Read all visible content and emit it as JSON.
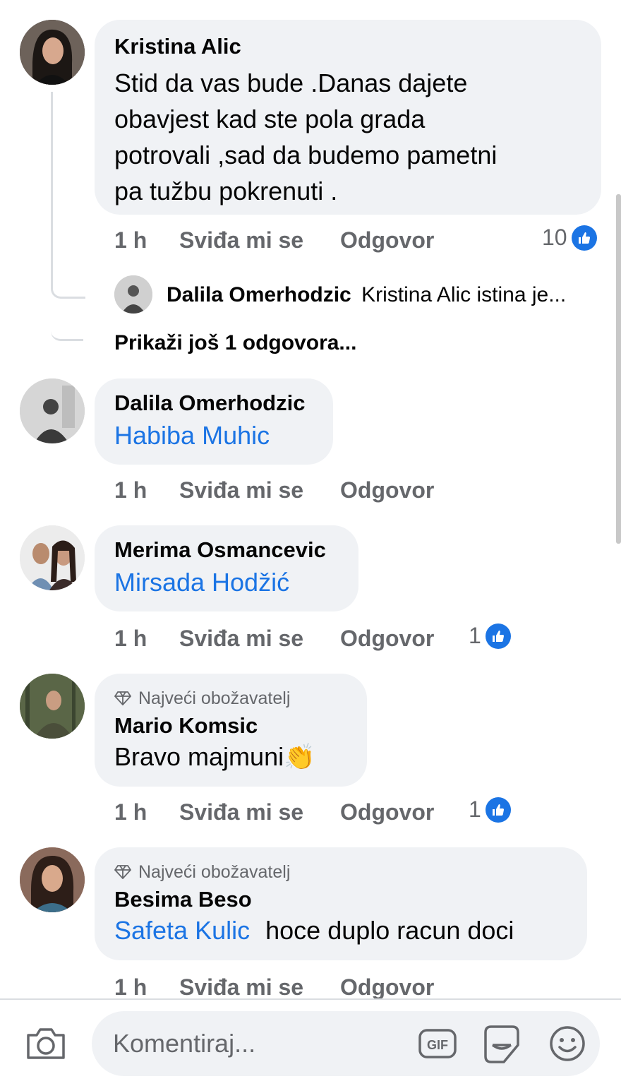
{
  "comments": [
    {
      "author": "Kristina Alic",
      "text_lines": [
        "Stid da vas bude .Danas dajete",
        "obavjest kad ste pola grada",
        "potrovali ,sad da budemo pametni",
        "pa tužbu pokrenuti ."
      ],
      "time": "1 h",
      "like_label": "Sviđa mi se",
      "reply_label": "Odgovor",
      "reactions": "10"
    },
    {
      "author": "Dalila Omerhodzic",
      "mention": "Habiba Muhic",
      "time": "1 h",
      "like_label": "Sviđa mi se",
      "reply_label": "Odgovor"
    },
    {
      "author": "Merima Osmancevic",
      "mention": "Mirsada Hodžić",
      "time": "1 h",
      "like_label": "Sviđa mi se",
      "reply_label": "Odgovor",
      "reactions": "1"
    },
    {
      "badge": "Najveći obožavatelj",
      "author": "Mario Komsic",
      "text": "Bravo majmuni",
      "emoji": "👏",
      "time": "1 h",
      "like_label": "Sviđa mi se",
      "reply_label": "Odgovor",
      "reactions": "1"
    },
    {
      "badge": "Najveći obožavatelj",
      "author": "Besima Beso",
      "mention": "Safeta Kulic",
      "text": "hoce duplo racun doci",
      "time": "1 h",
      "like_label": "Sviđa mi se",
      "reply_label": "Odgovor"
    }
  ],
  "reply_preview": {
    "author": "Dalila Omerhodzic",
    "text": "Kristina Alic istina je..."
  },
  "more_replies": "Prikaži još 1 odgovora...",
  "composer": {
    "placeholder": "Komentiraj..."
  },
  "colors": {
    "accent": "#1b74e4",
    "bubble": "#f0f2f5",
    "secondary_text": "#65676b"
  }
}
